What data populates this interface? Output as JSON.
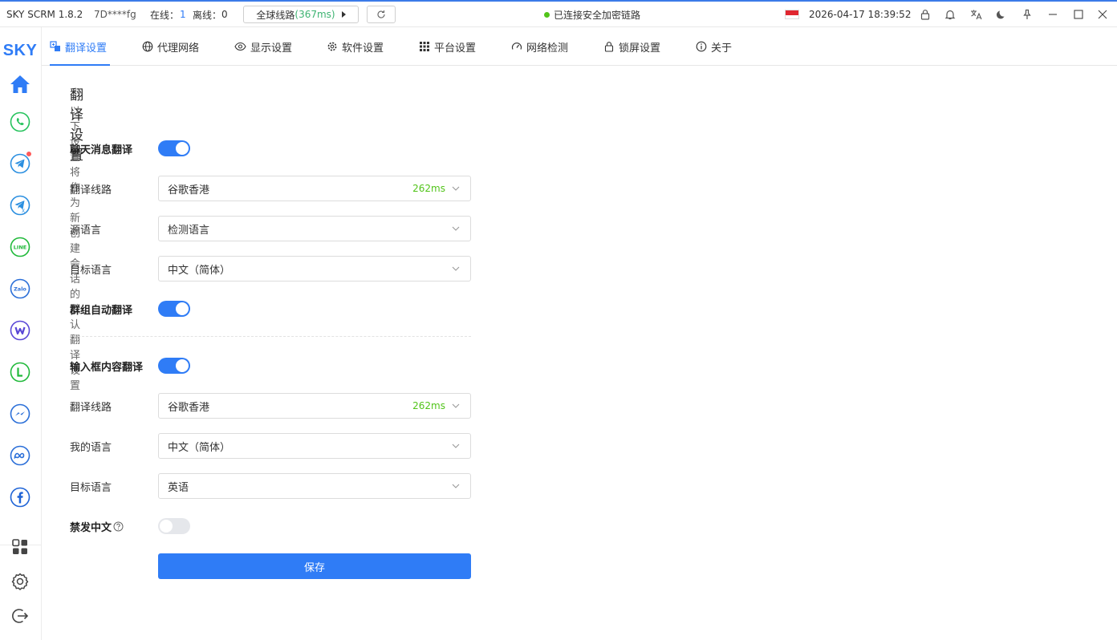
{
  "app": {
    "name": "SKY SCRM 1.8.2",
    "account": "7D****fg",
    "online_label": "在线：",
    "online_count": "1",
    "offline_label": "离线：",
    "offline_count": "0"
  },
  "route": {
    "label": "全球线路",
    "latency": "(367ms)"
  },
  "connection": {
    "status": "已连接安全加密链路"
  },
  "datetime": "2026-04-17 18:39:52",
  "sidebar": {
    "logo": "SKY",
    "items": [
      {
        "name": "home",
        "icon": "home-icon"
      },
      {
        "name": "whatsapp",
        "icon": "whatsapp-icon"
      },
      {
        "name": "telegram",
        "icon": "telegram-icon",
        "badge": true
      },
      {
        "name": "telegram-2",
        "icon": "telegram-alt-icon"
      },
      {
        "name": "line",
        "icon": "line-icon",
        "text": "LINE"
      },
      {
        "name": "zalo",
        "icon": "zalo-icon",
        "text": "Zalo"
      },
      {
        "name": "w-app",
        "icon": "w-icon",
        "text": "W"
      },
      {
        "name": "l-app",
        "icon": "l-icon",
        "text": "L"
      },
      {
        "name": "messenger",
        "icon": "messenger-icon"
      },
      {
        "name": "meta",
        "icon": "meta-icon"
      },
      {
        "name": "facebook",
        "icon": "facebook-icon",
        "text": "f"
      }
    ]
  },
  "tabs": [
    {
      "label": "翻译设置",
      "icon": "translate-icon",
      "active": true
    },
    {
      "label": "代理网络",
      "icon": "globe-icon"
    },
    {
      "label": "显示设置",
      "icon": "eye-icon"
    },
    {
      "label": "软件设置",
      "icon": "gear-icon"
    },
    {
      "label": "平台设置",
      "icon": "grid-icon"
    },
    {
      "label": "网络检测",
      "icon": "speedometer-icon"
    },
    {
      "label": "锁屏设置",
      "icon": "lock-icon"
    },
    {
      "label": "关于",
      "icon": "info-icon"
    }
  ],
  "section": {
    "title": "翻译设置",
    "subtitle": "以下设置将作为新创建会话的默认翻译设置",
    "chat_translate": {
      "label": "聊天消息翻译",
      "on": true
    },
    "chat_route": {
      "label": "翻译线路",
      "value": "谷歌香港",
      "latency": "262ms"
    },
    "source_lang": {
      "label": "源语言",
      "value": "检测语言"
    },
    "target_lang": {
      "label": "目标语言",
      "value": "中文（简体）"
    },
    "group_auto": {
      "label": "群组自动翻译",
      "on": true
    },
    "input_translate": {
      "label": "输入框内容翻译",
      "on": true
    },
    "input_route": {
      "label": "翻译线路",
      "value": "谷歌香港",
      "latency": "262ms"
    },
    "my_lang": {
      "label": "我的语言",
      "value": "中文（简体）"
    },
    "input_target_lang": {
      "label": "目标语言",
      "value": "英语"
    },
    "ban_chinese": {
      "label": "禁发中文",
      "on": false
    },
    "save_label": "保存"
  },
  "colors": {
    "accent": "#2f7cf6",
    "latency": "#52c41a",
    "connected": "#52c41a"
  }
}
